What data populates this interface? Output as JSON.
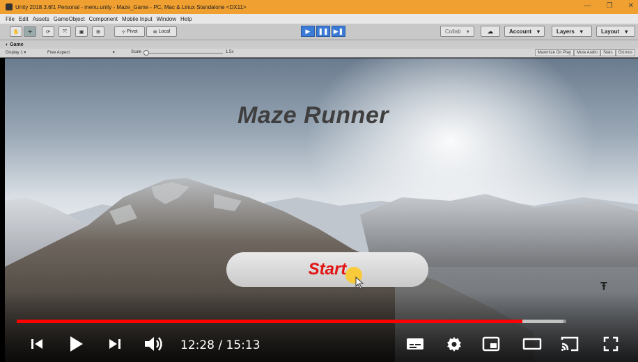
{
  "window": {
    "title": "Unity 2018.3.6f1 Personal - menu.unity - Maze_Game - PC, Mac & Linux Standalone <DX11>",
    "controls": [
      "—",
      "❐",
      "✕"
    ]
  },
  "menu": [
    "File",
    "Edit",
    "Assets",
    "GameObject",
    "Component",
    "Mobile Input",
    "Window",
    "Help"
  ],
  "toolbar": {
    "pivot_label": "Pivot",
    "local_label": "Local",
    "collab_label": "Collab",
    "account_label": "Account",
    "layers_label": "Layers",
    "layout_label": "Layout"
  },
  "game_view": {
    "tab_label": "Game",
    "display_label": "Display 1",
    "aspect_label": "Free Aspect",
    "scale_label": "Scale",
    "scale_value": "1.5x",
    "buttons": [
      "Maximize On Play",
      "Mute Audio",
      "Stats",
      "Gizmos"
    ]
  },
  "game": {
    "title": "Maze Runner",
    "start_label": "Start"
  },
  "player": {
    "current_time": "12:28",
    "duration": "15:13",
    "time_display": "12:28 / 15:13",
    "progress_fraction": 0.92,
    "buffer_fraction": 0.995
  },
  "colors": {
    "progress_red": "#ff0000",
    "start_text": "#e21515",
    "title_bar": "#f0a030"
  }
}
